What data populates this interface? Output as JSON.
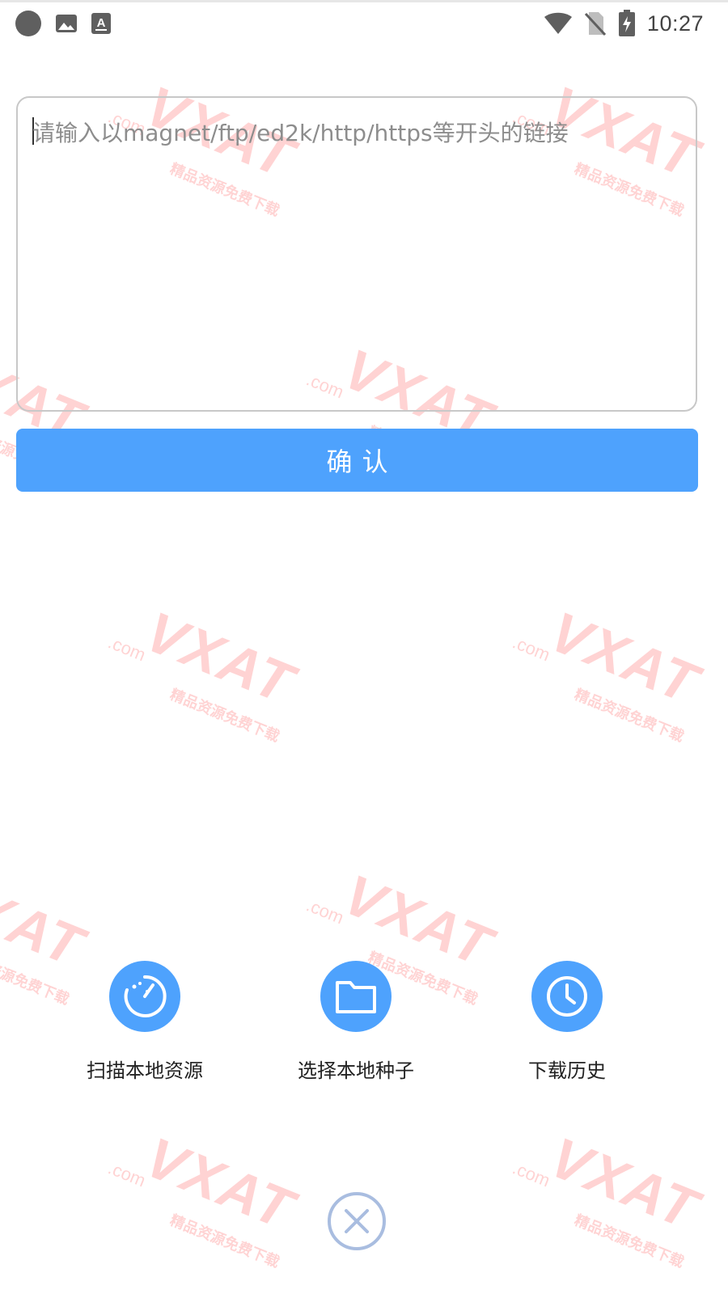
{
  "status_bar": {
    "time": "10:27",
    "left_icons": [
      "circle-notification-icon",
      "image-notification-icon",
      "font-notification-icon"
    ],
    "right_icons": [
      "wifi-icon",
      "no-sim-icon",
      "battery-charging-icon"
    ]
  },
  "link_input": {
    "placeholder": "请输入以magnet/ftp/ed2k/http/https等开头的链接",
    "value": ""
  },
  "confirm_button": {
    "label": "确认"
  },
  "actions": [
    {
      "label": "扫描本地资源",
      "icon": "radar-scan-icon"
    },
    {
      "label": "选择本地种子",
      "icon": "folder-icon"
    },
    {
      "label": "下载历史",
      "icon": "clock-icon"
    }
  ],
  "close_button": {
    "icon": "close-icon"
  },
  "watermark": {
    "text": "VXAT",
    "domain": ".com",
    "subtitle": "精品资源免费下载"
  },
  "colors": {
    "accent": "#4ea2fd",
    "close_icon": "#a9bde0",
    "border": "#c8c8c8",
    "watermark": "#ff3b3b"
  }
}
